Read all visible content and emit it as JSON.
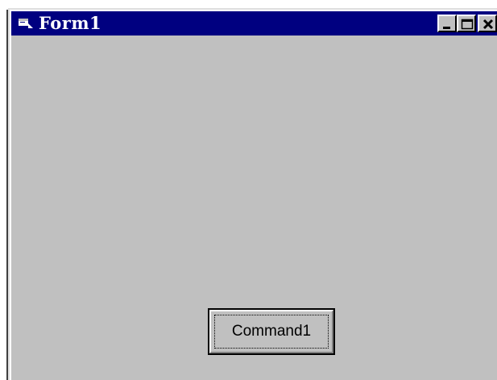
{
  "window": {
    "title": "Form1",
    "icon": "form-icon",
    "controls": {
      "minimize_icon": "minimize-icon",
      "maximize_icon": "maximize-icon",
      "close_icon": "close-icon"
    }
  },
  "form": {
    "command_button_label": "Command1"
  },
  "colors": {
    "titlebar": "#000080",
    "face": "#c0c0c0",
    "title_text": "#ffffff"
  }
}
